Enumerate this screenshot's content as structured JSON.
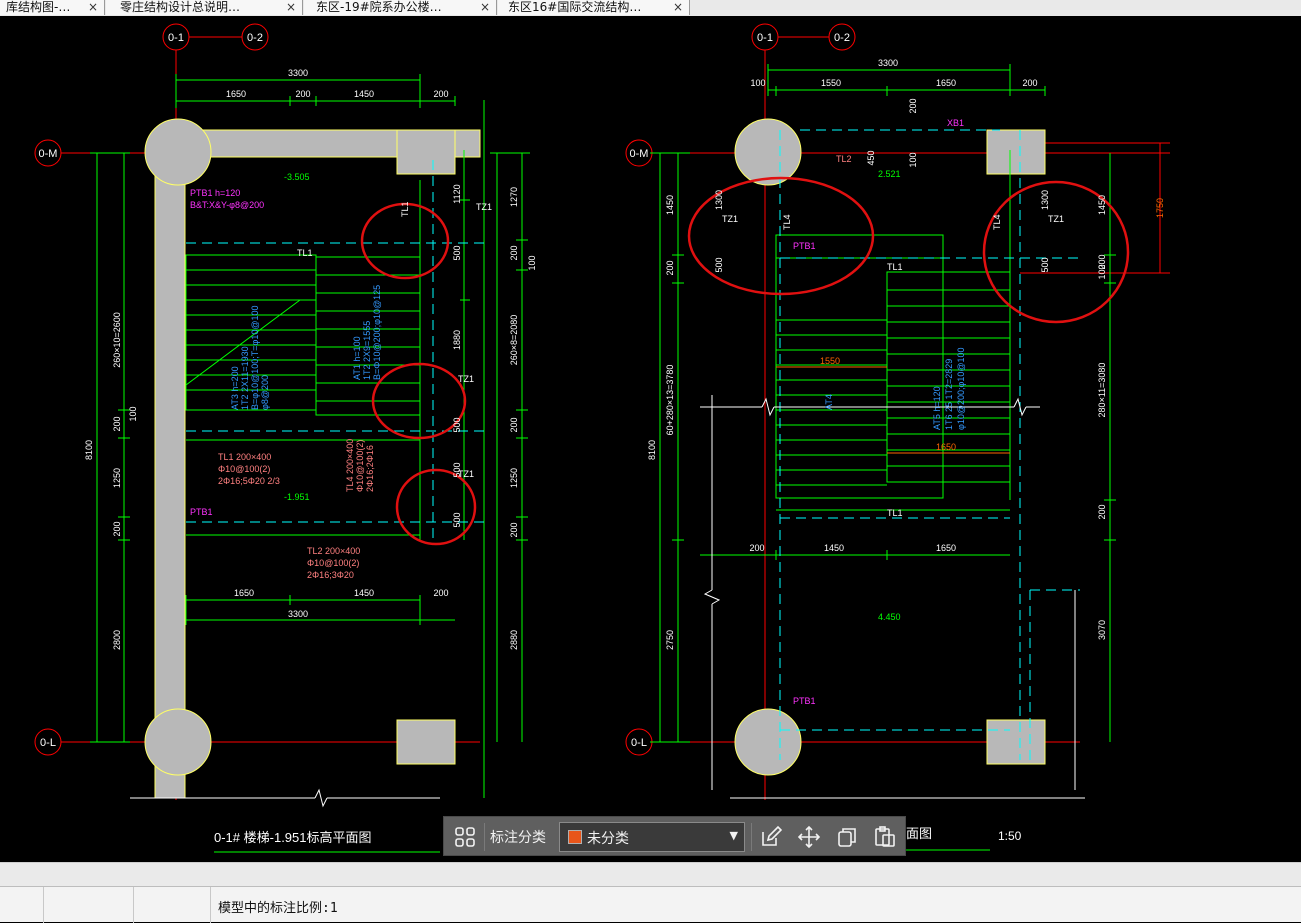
{
  "tabs": [
    {
      "label": "库结构图-…",
      "close": "×"
    },
    {
      "label": "零庄结构设计总说明…",
      "close": "×"
    },
    {
      "label": "东区-19#院系办公楼…",
      "close": "×"
    },
    {
      "label": "东区16#国际交流结构…",
      "close": "×"
    }
  ],
  "drawing": {
    "axes": {
      "col_a": "0-1",
      "col_b": "0-2",
      "row_top": "0-M",
      "row_bottom": "0-L"
    },
    "left_plan": {
      "dim_total": "3300",
      "dim_parts": [
        "1650",
        "200",
        "1450",
        "200"
      ],
      "dim_bottom_parts": [
        "1650",
        "1450",
        "200"
      ],
      "dim_bottom_total": "3300",
      "left_dims": [
        "8100",
        "260×10=2600",
        "1250",
        "200",
        "2800",
        "100",
        "200"
      ],
      "right_dims": [
        "1270",
        "200",
        "100",
        "260×8=2080",
        "200",
        "1250",
        "200",
        "2880"
      ],
      "inner_dims": [
        "1120",
        "500",
        "1880",
        "500",
        "500",
        "500"
      ],
      "level_top": "-3.505",
      "level_mid": "-1.951",
      "ptb_top": "PTB1  h=120",
      "ptb_top_2": "B&T:X&Y-φ8@200",
      "ptb_mid": "PTB1",
      "tl1_label": "TL1",
      "tl1_spec": [
        "TL1 200×400",
        "Φ10@100(2)",
        "2Φ16;5Φ20 2/3"
      ],
      "tl2_spec": [
        "TL2 200×400",
        "Φ10@100(2)",
        "2Φ16;3Φ20"
      ],
      "tl4_spec": [
        "TL4 200×400",
        "Φ10@100(2)",
        "2Φ16;2Φ16"
      ],
      "tz1": "TZ1",
      "at1_spec": [
        "AT1  h=100",
        "1T2 2X9=1555",
        "B=Φ10@200;φ10@125"
      ],
      "at3_spec": [
        "AT3  h=200",
        "1T2 2X11=1930",
        "B=φ10@100;T=φ10@100",
        "φ8@200"
      ],
      "tl_side": "TL1",
      "title": "0-1#  楼梯-1.951标高平面图",
      "scale": "1:50"
    },
    "right_plan": {
      "dim_total": "3300",
      "dim_parts": [
        "100",
        "1550",
        "1650",
        "200"
      ],
      "dim_bottom_parts": [
        "200",
        "1450",
        "1650"
      ],
      "left_dims": [
        "8100",
        "60+280×13=3780",
        "1450",
        "200",
        "2750"
      ],
      "right_dims": [
        "1450",
        "100",
        "200",
        "280×11=3080",
        "200",
        "3070"
      ],
      "inner_dims": [
        "1300",
        "500",
        "1300",
        "500",
        "1550",
        "1650",
        "200",
        "1750",
        "100",
        "450"
      ],
      "level_top": "2.521",
      "level_bottom": "4.450",
      "xb": "XB1",
      "tl2": "TL2",
      "tl4": "TL4",
      "ptb": "PTB1",
      "tl1": "TL1",
      "tz1": "TZ1",
      "at4": "AT4",
      "at5_spec": [
        "AT5  h=120",
        "1T6 25 1T2=2829",
        "φ10@200;φ10@100"
      ],
      "title_tail": "面图",
      "scale": "1:50"
    }
  },
  "toolbar": {
    "label": "标注分类",
    "select_value": "未分类",
    "swatch_color": "#e8551a",
    "icons": [
      "grid-icon",
      "edit-icon",
      "move-icon",
      "copy-icon",
      "paste-icon"
    ]
  },
  "status": {
    "text": "模型中的标注比例:1"
  },
  "colors": {
    "background": "#000000",
    "dim_green": "#00ff00",
    "axis_red": "#ff0000",
    "cyan": "#00ffff",
    "magenta": "#ff33ff",
    "blue_text": "#3399ff",
    "column_fill": "#c0c0c0",
    "wall_yellow": "#ffff66"
  }
}
